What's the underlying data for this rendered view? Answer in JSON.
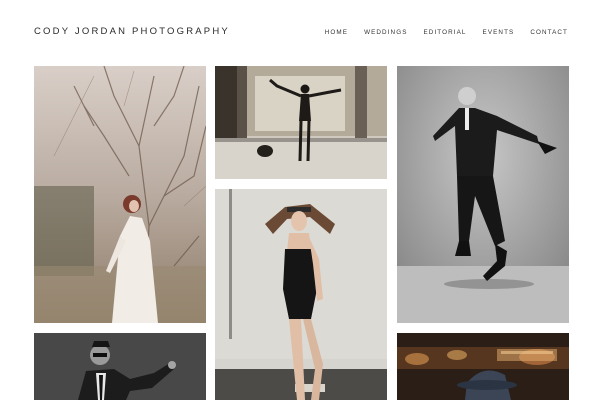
{
  "site": {
    "brand": "CODY JORDAN PHOTOGRAPHY"
  },
  "nav": {
    "items": [
      {
        "label": "HOME"
      },
      {
        "label": "WEDDINGS"
      },
      {
        "label": "EDITORIAL"
      },
      {
        "label": "EVENTS"
      },
      {
        "label": "CONTACT"
      }
    ]
  },
  "gallery": {
    "photos": [
      {
        "subject": "woman in white dress among bare branches"
      },
      {
        "subject": "dancer in industrial hall with raised arms"
      },
      {
        "subject": "man in suit mid-dance, black and white"
      },
      {
        "subject": "woman in black swimsuit with headband"
      },
      {
        "subject": "man in suit and sunglasses, black and white"
      },
      {
        "subject": "hat silhouette against city lights"
      }
    ]
  },
  "colors": {
    "background": "#ffffff",
    "text": "#2a2a2a"
  }
}
